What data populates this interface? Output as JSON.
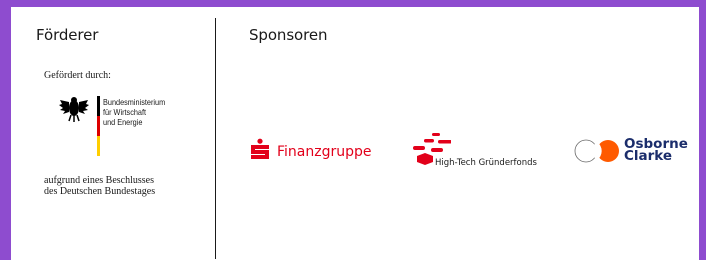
{
  "foerderer": {
    "title": "Förderer",
    "gefoerdert_label": "Gefördert durch:",
    "ministry_lines": [
      "Bundesministerium",
      "für Wirtschaft",
      "und Energie"
    ],
    "beschluss_lines": [
      "aufgrund eines Beschlusses",
      "des Deutschen Bundestages"
    ],
    "flag_colors": [
      "#000000",
      "#dd0000",
      "#ffce00"
    ]
  },
  "sponsoren": {
    "title": "Sponsoren",
    "logos": [
      {
        "name": "Finanzgruppe",
        "icon": "sparkasse-s-icon",
        "color": "#e2001a"
      },
      {
        "name": "High-Tech Gründerfonds",
        "icon": "htgf-icon",
        "color": "#e2001a"
      },
      {
        "name_lines": [
          "Osborne",
          "Clarke"
        ],
        "icon": "osborne-clarke-circles-icon",
        "color": "#1b2d6b",
        "accent": "#ff5a00"
      }
    ]
  },
  "colors": {
    "background": "#8e4ccf",
    "card": "#ffffff"
  }
}
